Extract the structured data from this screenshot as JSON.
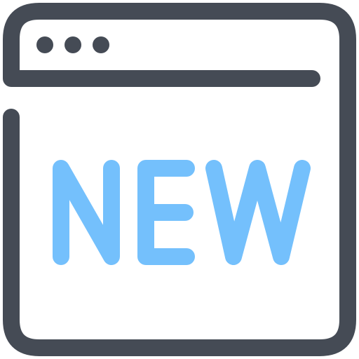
{
  "icon": {
    "name": "new-browser-window-icon",
    "badge_text": "NEW",
    "colors": {
      "outline": "#454B55",
      "badge": "#74C0FC",
      "background": "#FFFFFF"
    }
  }
}
